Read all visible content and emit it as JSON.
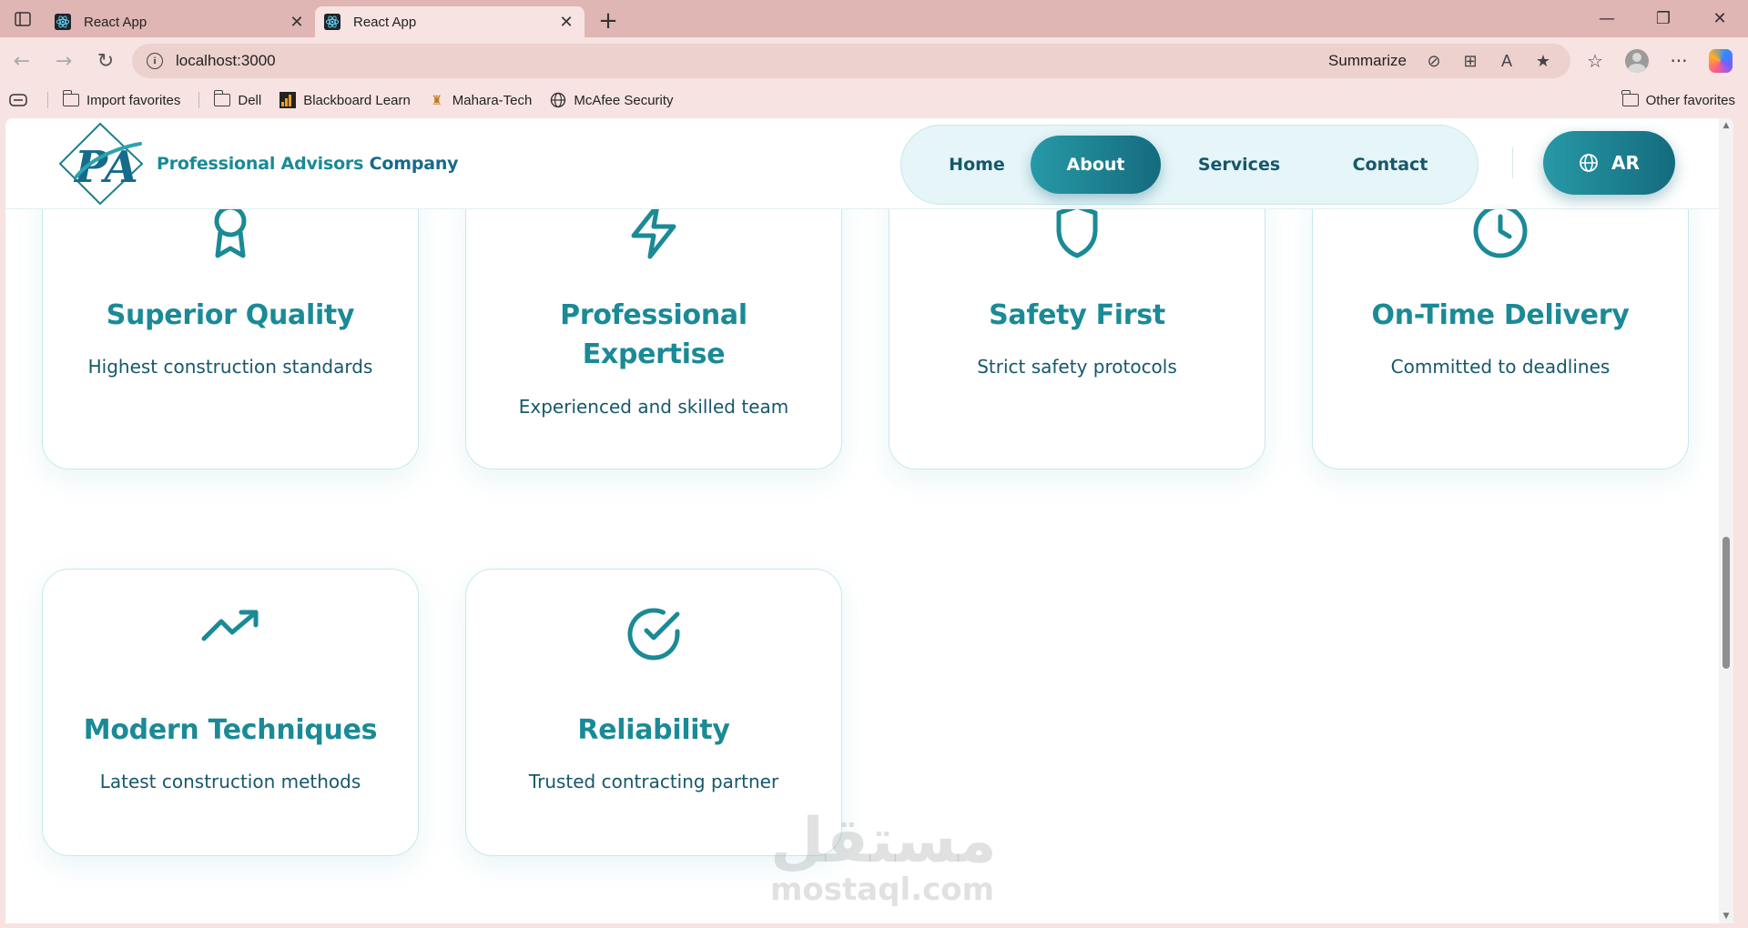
{
  "browser": {
    "tabs": [
      {
        "title": "React App",
        "active": false
      },
      {
        "title": "React App",
        "active": true
      }
    ],
    "address": {
      "url": "localhost:3000",
      "summarize_label": "Summarize"
    },
    "favorites": [
      {
        "label": "Import favorites",
        "icon": "import-icon"
      },
      {
        "label": "Dell",
        "icon": "folder-icon"
      },
      {
        "label": "Blackboard Learn",
        "icon": "blackboard-icon"
      },
      {
        "label": "Mahara-Tech",
        "icon": "mahara-icon"
      },
      {
        "label": "McAfee Security",
        "icon": "globe-icon"
      }
    ],
    "other_favorites": "Other favorites"
  },
  "site": {
    "brand": {
      "monogram": "PA",
      "name_part1": "Professional Advisors",
      "name_part2": "Company"
    },
    "nav": {
      "home": "Home",
      "about": "About",
      "services": "Services",
      "contact": "Contact",
      "active": "About"
    },
    "lang_button": "AR",
    "accent_color": "#1a8a96",
    "dark_color": "#146b7e"
  },
  "features": [
    {
      "icon": "award-icon",
      "title": "Superior Quality",
      "text": "Highest construction standards"
    },
    {
      "icon": "lightning-icon",
      "title": "Professional Expertise",
      "text": "Experienced and skilled team"
    },
    {
      "icon": "shield-icon",
      "title": "Safety First",
      "text": "Strict safety protocols"
    },
    {
      "icon": "clock-icon",
      "title": "On-Time Delivery",
      "text": "Committed to deadlines"
    },
    {
      "icon": "trending-up-icon",
      "title": "Modern Techniques",
      "text": "Latest construction methods"
    },
    {
      "icon": "check-circle-icon",
      "title": "Reliability",
      "text": "Trusted contracting partner"
    }
  ],
  "watermark": {
    "arabic": "مستقل",
    "latin": "mostaql.com"
  }
}
